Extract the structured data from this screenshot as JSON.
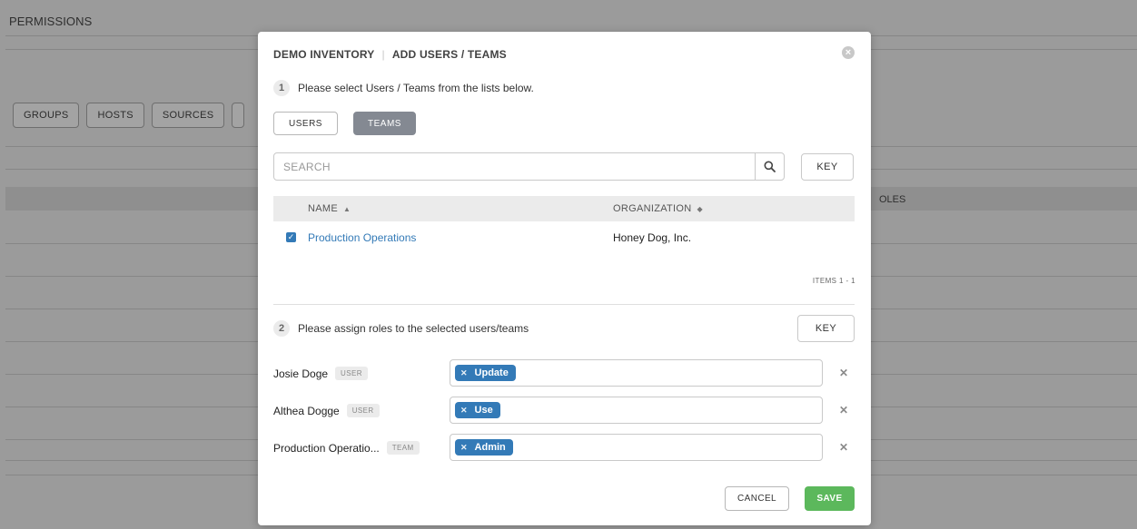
{
  "background": {
    "section_title": "PERMISSIONS",
    "buttons": [
      "GROUPS",
      "HOSTS",
      "SOURCES"
    ],
    "partial_column": "OLES"
  },
  "modal": {
    "inventory_name": "DEMO INVENTORY",
    "title": "ADD USERS / TEAMS",
    "step1": {
      "number": "1",
      "text": "Please select Users / Teams from the lists below."
    },
    "tabs": {
      "users": "USERS",
      "teams": "TEAMS",
      "active": "TEAMS"
    },
    "search": {
      "placeholder": "SEARCH",
      "value": ""
    },
    "key_label": "KEY",
    "table": {
      "columns": {
        "name": "NAME",
        "organization": "ORGANIZATION"
      },
      "rows": [
        {
          "name": "Production Operations",
          "organization": "Honey Dog, Inc.",
          "checked": true
        }
      ],
      "items_label": "ITEMS  1 - 1"
    },
    "step2": {
      "number": "2",
      "text": "Please assign roles to the selected users/teams"
    },
    "assignments": [
      {
        "name": "Josie Doge",
        "type": "USER",
        "role": "Update"
      },
      {
        "name": "Althea Dogge",
        "type": "USER",
        "role": "Use"
      },
      {
        "name": "Production Operatio...",
        "type": "TEAM",
        "role": "Admin"
      }
    ],
    "cancel_label": "CANCEL",
    "save_label": "SAVE"
  },
  "colors": {
    "accent": "#337ab7",
    "save": "#5cb85c",
    "tab_active": "#848992",
    "overlay": "#9b9b9b"
  }
}
